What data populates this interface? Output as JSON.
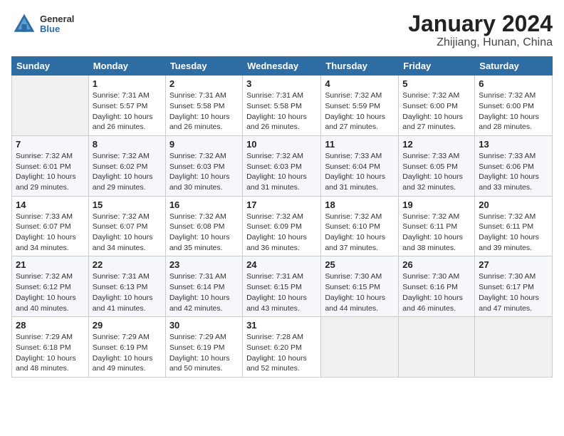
{
  "header": {
    "logo": {
      "general": "General",
      "blue": "Blue"
    },
    "title": "January 2024",
    "subtitle": "Zhijiang, Hunan, China"
  },
  "weekdays": [
    "Sunday",
    "Monday",
    "Tuesday",
    "Wednesday",
    "Thursday",
    "Friday",
    "Saturday"
  ],
  "weeks": [
    [
      {
        "day": "",
        "info": ""
      },
      {
        "day": "1",
        "info": "Sunrise: 7:31 AM\nSunset: 5:57 PM\nDaylight: 10 hours\nand 26 minutes."
      },
      {
        "day": "2",
        "info": "Sunrise: 7:31 AM\nSunset: 5:58 PM\nDaylight: 10 hours\nand 26 minutes."
      },
      {
        "day": "3",
        "info": "Sunrise: 7:31 AM\nSunset: 5:58 PM\nDaylight: 10 hours\nand 26 minutes."
      },
      {
        "day": "4",
        "info": "Sunrise: 7:32 AM\nSunset: 5:59 PM\nDaylight: 10 hours\nand 27 minutes."
      },
      {
        "day": "5",
        "info": "Sunrise: 7:32 AM\nSunset: 6:00 PM\nDaylight: 10 hours\nand 27 minutes."
      },
      {
        "day": "6",
        "info": "Sunrise: 7:32 AM\nSunset: 6:00 PM\nDaylight: 10 hours\nand 28 minutes."
      }
    ],
    [
      {
        "day": "7",
        "info": "Sunrise: 7:32 AM\nSunset: 6:01 PM\nDaylight: 10 hours\nand 29 minutes."
      },
      {
        "day": "8",
        "info": "Sunrise: 7:32 AM\nSunset: 6:02 PM\nDaylight: 10 hours\nand 29 minutes."
      },
      {
        "day": "9",
        "info": "Sunrise: 7:32 AM\nSunset: 6:03 PM\nDaylight: 10 hours\nand 30 minutes."
      },
      {
        "day": "10",
        "info": "Sunrise: 7:32 AM\nSunset: 6:03 PM\nDaylight: 10 hours\nand 31 minutes."
      },
      {
        "day": "11",
        "info": "Sunrise: 7:33 AM\nSunset: 6:04 PM\nDaylight: 10 hours\nand 31 minutes."
      },
      {
        "day": "12",
        "info": "Sunrise: 7:33 AM\nSunset: 6:05 PM\nDaylight: 10 hours\nand 32 minutes."
      },
      {
        "day": "13",
        "info": "Sunrise: 7:33 AM\nSunset: 6:06 PM\nDaylight: 10 hours\nand 33 minutes."
      }
    ],
    [
      {
        "day": "14",
        "info": "Sunrise: 7:33 AM\nSunset: 6:07 PM\nDaylight: 10 hours\nand 34 minutes."
      },
      {
        "day": "15",
        "info": "Sunrise: 7:32 AM\nSunset: 6:07 PM\nDaylight: 10 hours\nand 34 minutes."
      },
      {
        "day": "16",
        "info": "Sunrise: 7:32 AM\nSunset: 6:08 PM\nDaylight: 10 hours\nand 35 minutes."
      },
      {
        "day": "17",
        "info": "Sunrise: 7:32 AM\nSunset: 6:09 PM\nDaylight: 10 hours\nand 36 minutes."
      },
      {
        "day": "18",
        "info": "Sunrise: 7:32 AM\nSunset: 6:10 PM\nDaylight: 10 hours\nand 37 minutes."
      },
      {
        "day": "19",
        "info": "Sunrise: 7:32 AM\nSunset: 6:11 PM\nDaylight: 10 hours\nand 38 minutes."
      },
      {
        "day": "20",
        "info": "Sunrise: 7:32 AM\nSunset: 6:11 PM\nDaylight: 10 hours\nand 39 minutes."
      }
    ],
    [
      {
        "day": "21",
        "info": "Sunrise: 7:32 AM\nSunset: 6:12 PM\nDaylight: 10 hours\nand 40 minutes."
      },
      {
        "day": "22",
        "info": "Sunrise: 7:31 AM\nSunset: 6:13 PM\nDaylight: 10 hours\nand 41 minutes."
      },
      {
        "day": "23",
        "info": "Sunrise: 7:31 AM\nSunset: 6:14 PM\nDaylight: 10 hours\nand 42 minutes."
      },
      {
        "day": "24",
        "info": "Sunrise: 7:31 AM\nSunset: 6:15 PM\nDaylight: 10 hours\nand 43 minutes."
      },
      {
        "day": "25",
        "info": "Sunrise: 7:30 AM\nSunset: 6:15 PM\nDaylight: 10 hours\nand 44 minutes."
      },
      {
        "day": "26",
        "info": "Sunrise: 7:30 AM\nSunset: 6:16 PM\nDaylight: 10 hours\nand 46 minutes."
      },
      {
        "day": "27",
        "info": "Sunrise: 7:30 AM\nSunset: 6:17 PM\nDaylight: 10 hours\nand 47 minutes."
      }
    ],
    [
      {
        "day": "28",
        "info": "Sunrise: 7:29 AM\nSunset: 6:18 PM\nDaylight: 10 hours\nand 48 minutes."
      },
      {
        "day": "29",
        "info": "Sunrise: 7:29 AM\nSunset: 6:19 PM\nDaylight: 10 hours\nand 49 minutes."
      },
      {
        "day": "30",
        "info": "Sunrise: 7:29 AM\nSunset: 6:19 PM\nDaylight: 10 hours\nand 50 minutes."
      },
      {
        "day": "31",
        "info": "Sunrise: 7:28 AM\nSunset: 6:20 PM\nDaylight: 10 hours\nand 52 minutes."
      },
      {
        "day": "",
        "info": ""
      },
      {
        "day": "",
        "info": ""
      },
      {
        "day": "",
        "info": ""
      }
    ]
  ]
}
